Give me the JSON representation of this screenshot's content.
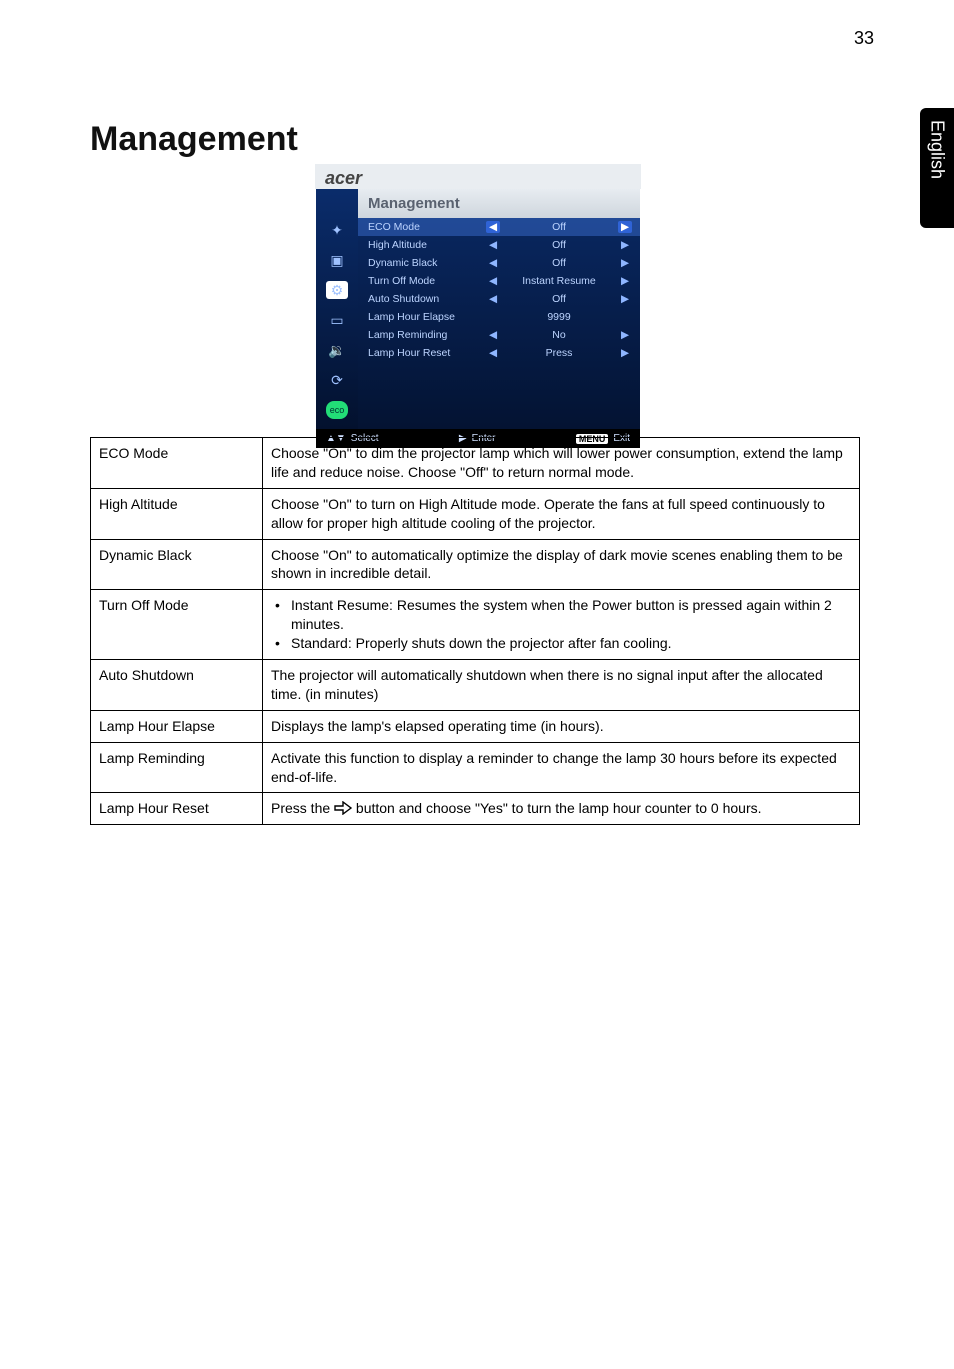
{
  "page_number": "33",
  "side_tab": "English",
  "heading": "Management",
  "osd": {
    "logo": "acer",
    "title": "Management",
    "rows": [
      {
        "label": "ECO Mode",
        "value": "Off",
        "selected": true
      },
      {
        "label": "High Altitude",
        "value": "Off",
        "selected": false
      },
      {
        "label": "Dynamic Black",
        "value": "Off",
        "selected": false
      },
      {
        "label": "Turn Off Mode",
        "value": "Instant Resume",
        "selected": false
      },
      {
        "label": "Auto Shutdown",
        "value": "Off",
        "selected": false
      },
      {
        "label": "Lamp Hour Elapse",
        "value": "9999",
        "selected": false,
        "noarrows": true
      },
      {
        "label": "Lamp Reminding",
        "value": "No",
        "selected": false
      },
      {
        "label": "Lamp Hour Reset",
        "value": "Press",
        "selected": false
      }
    ],
    "footer": {
      "select_glyph": "▲▼",
      "select_text": "Select",
      "enter_glyph": "▶",
      "enter_text": "Enter",
      "exit_pill": "MENU",
      "exit_text": "Exit"
    },
    "icons": [
      "✦",
      "▣",
      "⚙",
      "▭",
      "🔉",
      "⟳",
      "eco"
    ]
  },
  "table": [
    {
      "name": "ECO Mode",
      "desc_plain": "Choose \"On\" to dim the projector lamp which will lower power consumption, extend the lamp life and reduce noise.  Choose \"Off\" to return normal mode."
    },
    {
      "name": "High Altitude",
      "desc_plain": "Choose \"On\" to turn on High Altitude mode. Operate the fans at full speed continuously to allow for proper high altitude cooling of the projector."
    },
    {
      "name": "Dynamic Black",
      "desc_plain": "Choose \"On\" to automatically optimize the display of dark movie scenes enabling them to be shown in incredible detail."
    },
    {
      "name": "Turn Off Mode",
      "bullets": [
        "Instant Resume: Resumes the system when the Power button is pressed again within 2 minutes.",
        "Standard: Properly shuts down the projector after fan cooling."
      ]
    },
    {
      "name": "Auto Shutdown",
      "desc_plain": "The projector will automatically shutdown when there is no signal input after the allocated time. (in minutes)"
    },
    {
      "name": "Lamp Hour Elapse",
      "desc_plain": "Displays the lamp's elapsed operating time (in hours)."
    },
    {
      "name": "Lamp Reminding",
      "desc_plain": "Activate this function to display a reminder to change the lamp 30 hours before its expected end-of-life."
    },
    {
      "name": "Lamp Hour Reset",
      "desc_parts": {
        "prefix": "Press the ",
        "icon": "right-arrow-outline",
        "suffix": " button and choose \"Yes\" to turn the lamp hour counter to 0 hours."
      }
    }
  ]
}
